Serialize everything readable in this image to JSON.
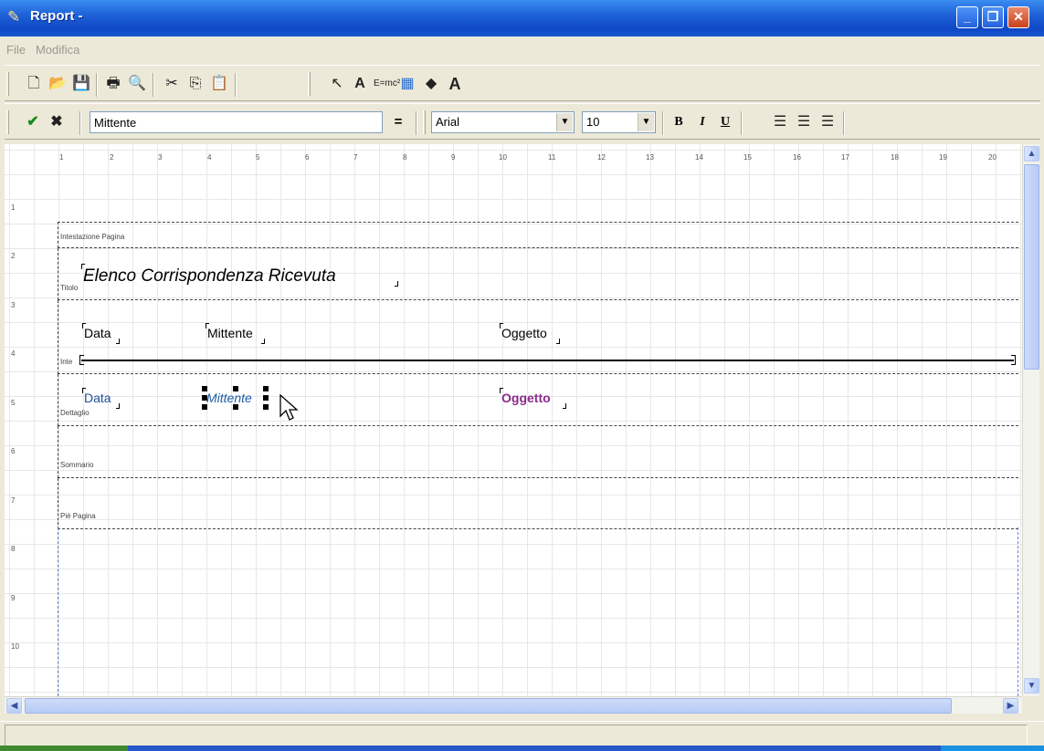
{
  "window": {
    "title": "Report -",
    "icon": "report-app-icon",
    "controls": [
      "minimize",
      "restore",
      "close"
    ]
  },
  "menu": [
    "File",
    "Modifica"
  ],
  "toolbar_main": {
    "icons": [
      "new-document-icon",
      "open-folder-icon",
      "save-icon",
      "print-icon",
      "print-preview-icon",
      "cut-icon",
      "copy-icon",
      "paste-icon",
      "pointer-tool-icon",
      "label-tool-icon",
      "expression-tool-icon",
      "image-tool-icon",
      "shape-tool-icon",
      "text-tool-icon"
    ]
  },
  "toolbar_format": {
    "confirm_icon": "check-icon",
    "cancel_icon": "x-icon",
    "field_value": "Mittente",
    "equals_label": "=",
    "font_name": "Arial",
    "font_size": "10",
    "bold_label": "B",
    "italic_label": "I",
    "underline_label": "U",
    "align_icons": [
      "align-left-icon",
      "align-center-icon",
      "align-right-icon"
    ]
  },
  "ruler": {
    "top": [
      "1",
      "2",
      "3",
      "4",
      "5",
      "6",
      "7",
      "8",
      "9",
      "10",
      "11",
      "12",
      "13",
      "14",
      "15",
      "16",
      "17",
      "18",
      "19",
      "20"
    ],
    "left": [
      "1",
      "2",
      "3",
      "4",
      "5",
      "6",
      "7",
      "8",
      "9",
      "10"
    ]
  },
  "bands": {
    "page_header": "Intestazione Pagina",
    "title": "Titolo",
    "column_header": "Inte",
    "detail": "Dettaglio",
    "summary": "Sommario",
    "page_footer": "Piè Pagina"
  },
  "fields": {
    "report_title": "Elenco Corrispondenza Ricevuta",
    "hdr_data": "Data",
    "hdr_mittente": "Mittente",
    "hdr_oggetto": "Oggetto",
    "det_data": "Data",
    "det_mittente": "Mittente",
    "det_oggetto": "Oggetto"
  },
  "colors": {
    "detail_data": "#1f4e9a",
    "detail_mittente": "#1f5ea8",
    "detail_oggetto": "#8a2a8a",
    "titlebar": "#1c5ed6"
  }
}
